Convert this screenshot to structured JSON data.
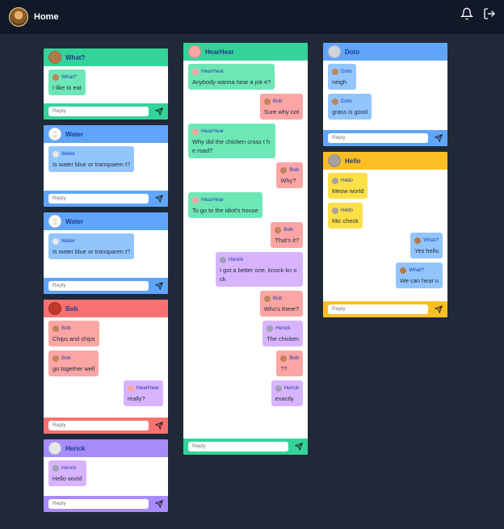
{
  "topbar": {
    "title": "Home",
    "icons": [
      "bell-icon",
      "logout-icon"
    ]
  },
  "reply_placeholder": "Reply",
  "column1": [
    {
      "name": "What?",
      "messages": [
        {
          "from": "What?",
          "text": "I like to eat"
        }
      ]
    },
    {
      "name": "Water",
      "messages": [
        {
          "from": "Water",
          "text": "Is water blue or transpaern t?"
        }
      ]
    },
    {
      "name": "Water",
      "messages": [
        {
          "from": "Water",
          "text": "Is water blue or transparen t?"
        }
      ]
    },
    {
      "name": "Bob",
      "messages": [
        {
          "from": "Bob",
          "text": "Chips and chips"
        },
        {
          "from": "Bob",
          "text": "go together well"
        },
        {
          "from": "HearHear",
          "text": "really?"
        }
      ]
    },
    {
      "name": "Herick",
      "messages": [
        {
          "from": "Herick",
          "text": "Hello world"
        }
      ]
    }
  ],
  "column2": [
    {
      "name": "HearHear",
      "messages": [
        {
          "from": "HearHear",
          "text": "Anybody wanna hear a jok e?"
        },
        {
          "from": "Bob",
          "text": "Sure why not"
        },
        {
          "from": "HearHear",
          "text": "Why did the chicken cross t he road?"
        },
        {
          "from": "Bob",
          "text": "Why?"
        },
        {
          "from": "HearHear",
          "text": "To go to the idiot's house"
        },
        {
          "from": "Bob",
          "text": "That's it?"
        },
        {
          "from": "Herick",
          "text": "I got a better one, knock kn ock"
        },
        {
          "from": "Bob",
          "text": "Who's there?"
        },
        {
          "from": "Herick",
          "text": "The chicken"
        },
        {
          "from": "Bob",
          "text": "??"
        },
        {
          "from": "Herick",
          "text": "exactly"
        }
      ]
    }
  ],
  "column3": [
    {
      "name": "Doto",
      "messages": [
        {
          "from": "Doto",
          "text": "neigh"
        },
        {
          "from": "Doto",
          "text": "grass is good"
        }
      ]
    },
    {
      "name": "Hello",
      "messages": [
        {
          "from": "Hello",
          "text": "Meow world"
        },
        {
          "from": "Hello",
          "text": "Mic check"
        },
        {
          "from": "What?",
          "text": "Yes hello"
        },
        {
          "from": "What?",
          "text": "We can hear u"
        }
      ]
    }
  ]
}
